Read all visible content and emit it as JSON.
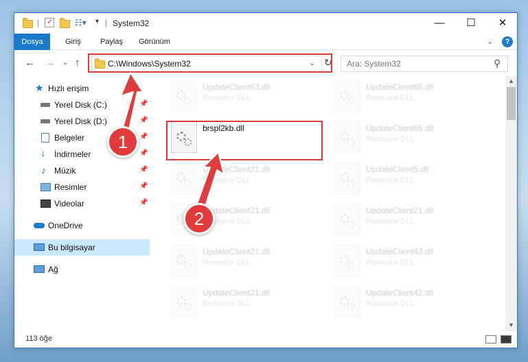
{
  "window": {
    "title": "System32"
  },
  "window_controls": {
    "minimize": "—",
    "maximize": "☐",
    "close": "✕"
  },
  "ribbon": {
    "tabs": [
      "Dosya",
      "Giriş",
      "Paylaş",
      "Görünüm"
    ],
    "help": "?"
  },
  "address_bar": {
    "path": "C:\\Windows\\System32"
  },
  "search": {
    "placeholder": "Ara: System32"
  },
  "sidebar": {
    "quick_access": "Hızlı erişim",
    "items": [
      "Yerel Disk (C:)",
      "Yerel Disk (D:)",
      "Belgeler",
      "İndirmeler",
      "Müzik",
      "Resimler",
      "Videolar"
    ],
    "onedrive": "OneDrive",
    "this_pc": "Bu bilgisayar",
    "network": "Ağ"
  },
  "files": [
    {
      "name": "UpdateClient63.dll",
      "type": "Resource DLL"
    },
    {
      "name": "UpdateClient65.dll",
      "type": "Resource DLL"
    },
    {
      "name": "brspl2kb.dll",
      "type": ""
    },
    {
      "name": "UpdateClient65.dll",
      "type": "Resource DLL"
    },
    {
      "name": "UpdateClient21.dll",
      "type": "Resource DLL"
    },
    {
      "name": "UpdateClient5.dll",
      "type": "Resource DLL"
    },
    {
      "name": "UpdateClient21.dll",
      "type": "Resource DLL"
    },
    {
      "name": "UpdateClient21.dll",
      "type": "Resource DLL"
    },
    {
      "name": "UpdateClient21.dll",
      "type": "Resource DLL"
    },
    {
      "name": "UpdateClient42.dll",
      "type": "Resource DLL"
    },
    {
      "name": "UpdateClient21.dll",
      "type": "Resource DLL"
    },
    {
      "name": "UpdateClient42.dll",
      "type": "Resource DLL"
    }
  ],
  "status": {
    "count": "113 öğe"
  },
  "annotations": {
    "step1": "1",
    "step2": "2",
    "color": "#e23b3b"
  }
}
